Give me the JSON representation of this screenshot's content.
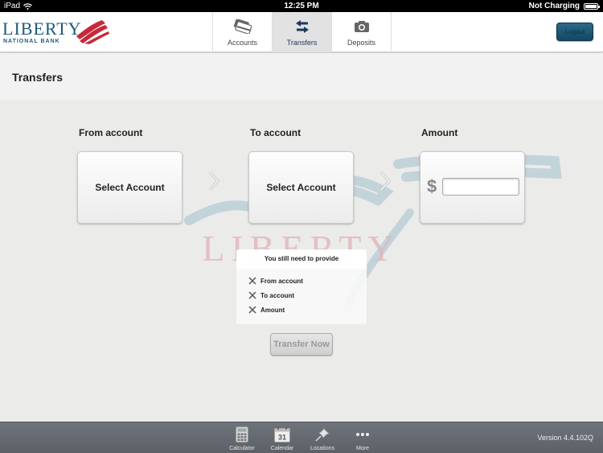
{
  "status_bar": {
    "device": "iPad",
    "time": "12:25 PM",
    "battery_status": "Not Charging",
    "icons": [
      "wifi-icon",
      "battery-icon"
    ]
  },
  "header": {
    "logo": {
      "name": "LIBERTY",
      "sub": "NATIONAL BANK"
    },
    "tabs": [
      {
        "label": "Accounts",
        "icon": "credit-cards-icon",
        "active": false
      },
      {
        "label": "Transfers",
        "icon": "transfer-arrows-icon",
        "active": true
      },
      {
        "label": "Deposits",
        "icon": "camera-icon",
        "active": false
      }
    ],
    "logout_label": "Logout"
  },
  "page": {
    "title": "Transfers"
  },
  "transfer": {
    "from": {
      "label": "From account",
      "button": "Select Account"
    },
    "to": {
      "label": "To account",
      "button": "Select Account"
    },
    "amount": {
      "label": "Amount",
      "currency_symbol": "$",
      "value": "",
      "placeholder": ""
    },
    "watermark": "LIBERTY",
    "requirements": {
      "title": "You still need to provide",
      "items": [
        "From account",
        "To account",
        "Amount"
      ]
    },
    "submit_label": "Transfer Now"
  },
  "bottom_bar": {
    "tools": [
      {
        "label": "Calculator",
        "icon": "calculator-icon"
      },
      {
        "label": "Calendar",
        "icon": "calendar-icon",
        "day": "31"
      },
      {
        "label": "Locations",
        "icon": "pushpin-icon"
      },
      {
        "label": "More",
        "icon": "more-dots-icon"
      }
    ],
    "version": "Version 4.4.102Q"
  },
  "colors": {
    "brand_blue": "#1f5a78",
    "brand_red": "#c8283a",
    "logout_button": "#1d5a78",
    "active_tab_text": "#1b3a5c"
  }
}
